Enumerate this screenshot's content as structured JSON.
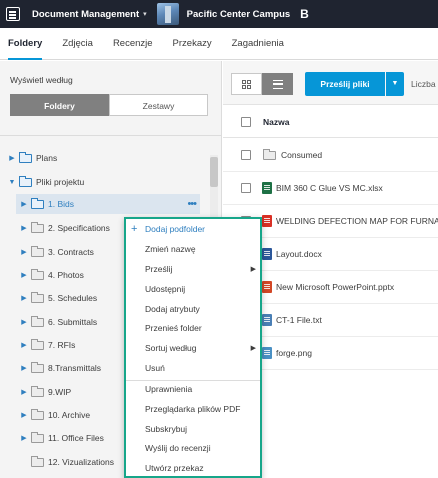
{
  "topbar": {
    "app_title": "Document Management",
    "project_name": "Pacific Center Campus",
    "app_icon": "document-management-icon",
    "project_icon": "project-thumbnail",
    "bim_icon": "B"
  },
  "tabs": [
    {
      "label": "Foldery",
      "active": true
    },
    {
      "label": "Zdjęcia"
    },
    {
      "label": "Recenzje"
    },
    {
      "label": "Przekazy"
    },
    {
      "label": "Zagadnienia"
    }
  ],
  "left": {
    "view_label": "Wyświetl według",
    "segments": [
      "Foldery",
      "Zestawy"
    ],
    "tree": [
      {
        "label": "Plans",
        "level": 0,
        "expanded": false
      },
      {
        "label": "Pliki projektu",
        "level": 0,
        "expanded": true
      },
      {
        "label": "1. Bids",
        "level": 1,
        "selected": true
      },
      {
        "label": "2. Specifications",
        "level": 1
      },
      {
        "label": "3. Contracts",
        "level": 1
      },
      {
        "label": "4. Photos",
        "level": 1
      },
      {
        "label": "5. Schedules",
        "level": 1
      },
      {
        "label": "6. Submittals",
        "level": 1
      },
      {
        "label": "7. RFIs",
        "level": 1
      },
      {
        "label": "8.Transmittals",
        "level": 1
      },
      {
        "label": "9.WIP",
        "level": 1
      },
      {
        "label": "10. Archive",
        "level": 1
      },
      {
        "label": "11. Office Files",
        "level": 1
      },
      {
        "label": "12. Vizualizations",
        "level": 1
      }
    ]
  },
  "right": {
    "upload_label": "Prześlij pliki",
    "count_label": "Liczba",
    "column_name": "Nazwa",
    "files": [
      {
        "name": "Consumed",
        "icon": "folder"
      },
      {
        "name": "BIM 360 C Glue VS MC.xlsx",
        "icon": "xls"
      },
      {
        "name": "WELDING DEFECTION MAP FOR FURNACE",
        "icon": "pdf"
      },
      {
        "name": "Layout.docx",
        "icon": "doc"
      },
      {
        "name": "New Microsoft PowerPoint.pptx",
        "icon": "ppt"
      },
      {
        "name": "CT-1 File.txt",
        "icon": "txt"
      },
      {
        "name": "forge.png",
        "icon": "img"
      }
    ]
  },
  "menu": {
    "items": [
      {
        "label": "Dodaj podfolder"
      },
      {
        "label": "Zmień nazwę"
      },
      {
        "label": "Prześlij",
        "submenu": true
      },
      {
        "label": "Udostępnij"
      },
      {
        "label": "Dodaj atrybuty"
      },
      {
        "label": "Przenieś folder"
      },
      {
        "label": "Sortuj według",
        "submenu": true
      },
      {
        "label": "Usuń"
      },
      {
        "label": "Uprawnienia"
      },
      {
        "label": "Przeglądarka plików PDF"
      },
      {
        "label": "Subskrybuj"
      },
      {
        "label": "Wyślij do recenzji"
      },
      {
        "label": "Utwórz przekaz"
      }
    ]
  },
  "colors": {
    "topbar": "#1f2430",
    "accent": "#0696d7",
    "menu_border": "#17a68a",
    "selected_row": "#dbe5ef"
  }
}
